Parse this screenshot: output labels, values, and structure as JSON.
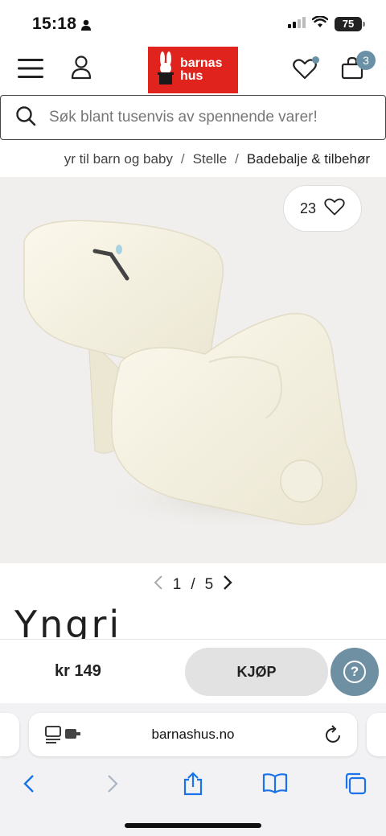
{
  "status_bar": {
    "time": "15:18",
    "battery": "75",
    "icons": [
      "person-icon",
      "signal-icon",
      "wifi-icon",
      "battery-icon"
    ]
  },
  "header": {
    "logo_line1": "barnas",
    "logo_line2": "hus",
    "cart_count": "3",
    "icons": [
      "menu-icon",
      "account-icon",
      "wishlist-icon",
      "cart-icon"
    ],
    "brand_color": "#e0231c",
    "accent_color": "#6a90a6"
  },
  "search": {
    "placeholder": "Søk blant tusenvis av spennende varer!"
  },
  "breadcrumb": {
    "items": [
      "yr til barn og baby",
      "Stelle",
      "Badebalje & tilbehør"
    ],
    "separator": "/"
  },
  "product": {
    "like_count": "23",
    "pager": {
      "current": "1",
      "separator": "/",
      "total": "5"
    },
    "brand_name": "Yngri",
    "image_description_icon": "bath-seat-image"
  },
  "buy_bar": {
    "price": "kr 149",
    "buy_label": "KJØP",
    "help_label": "?"
  },
  "browser": {
    "url": "barnashus.no",
    "icons": [
      "reader-icon",
      "reload-icon",
      "back-icon",
      "forward-icon",
      "share-icon",
      "bookmarks-icon",
      "tabs-icon"
    ]
  }
}
